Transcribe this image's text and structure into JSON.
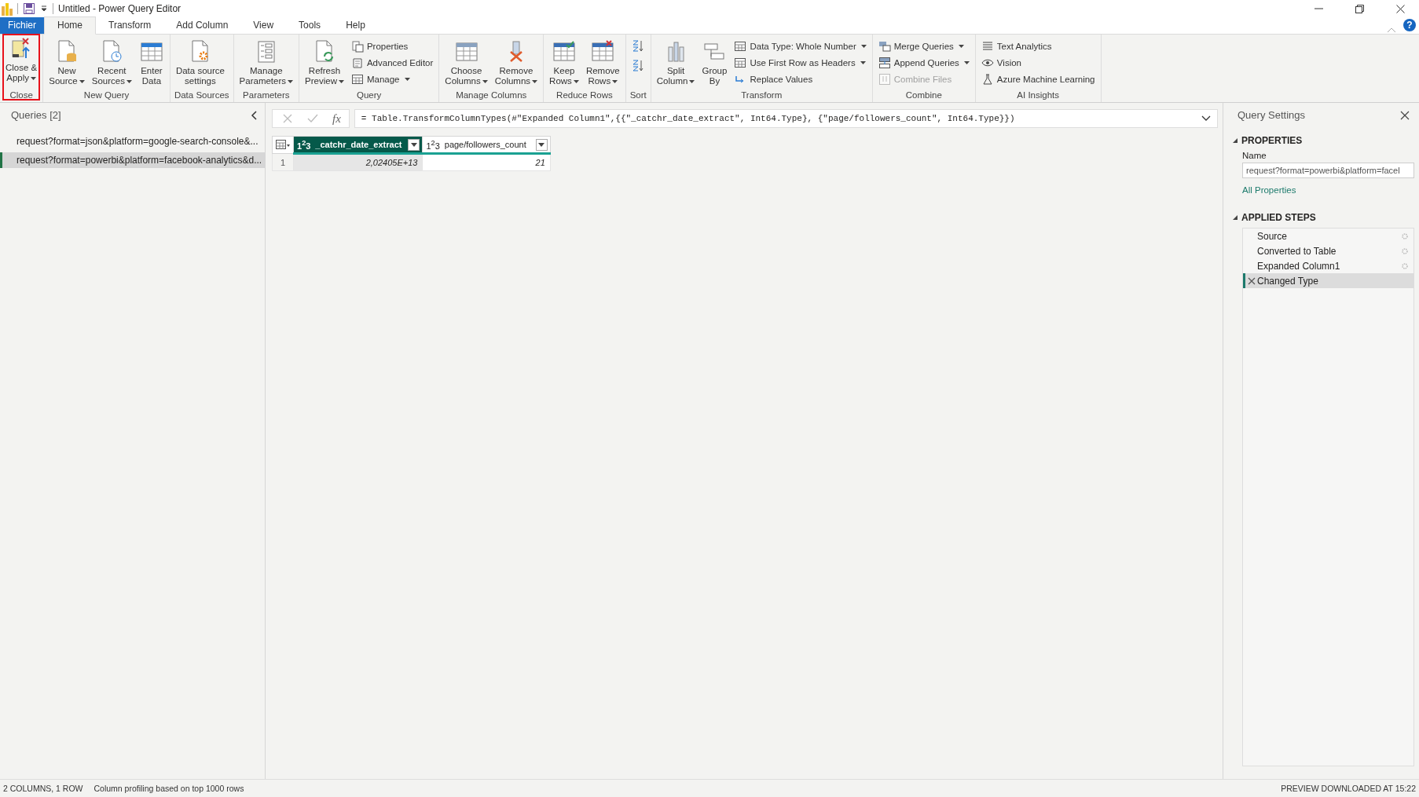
{
  "window": {
    "title": "Untitled - Power Query Editor",
    "help": "?"
  },
  "tabs": [
    {
      "label": "Fichier",
      "kind": "file",
      "selected": false
    },
    {
      "label": "Home",
      "kind": "tab",
      "selected": true
    },
    {
      "label": "Transform",
      "kind": "tab",
      "selected": false
    },
    {
      "label": "Add Column",
      "kind": "tab",
      "selected": false
    },
    {
      "label": "View",
      "kind": "tab",
      "selected": false
    },
    {
      "label": "Tools",
      "kind": "tab",
      "selected": false
    },
    {
      "label": "Help",
      "kind": "tab",
      "selected": false
    }
  ],
  "ribbon": [
    {
      "label": "Close",
      "items": [
        {
          "kind": "large",
          "lines": [
            "Close &",
            "Apply"
          ],
          "dropdown": true,
          "highlighted": true
        }
      ]
    },
    {
      "label": "New Query",
      "items": [
        {
          "kind": "large",
          "lines": [
            "New",
            "Source"
          ],
          "dropdown": true
        },
        {
          "kind": "large",
          "lines": [
            "Recent",
            "Sources"
          ],
          "dropdown": true
        },
        {
          "kind": "large",
          "lines": [
            "Enter",
            "Data"
          ],
          "dropdown": false
        }
      ]
    },
    {
      "label": "Data Sources",
      "items": [
        {
          "kind": "large",
          "lines": [
            "Data source",
            "settings"
          ],
          "dropdown": false
        }
      ]
    },
    {
      "label": "Parameters",
      "items": [
        {
          "kind": "large",
          "lines": [
            "Manage",
            "Parameters"
          ],
          "dropdown": true
        }
      ]
    },
    {
      "label": "Query",
      "items": [
        {
          "kind": "large",
          "lines": [
            "Refresh",
            "Preview"
          ],
          "dropdown": true
        },
        {
          "kind": "small",
          "label": "Properties",
          "dropdown": false,
          "disabled": false
        },
        {
          "kind": "small",
          "label": "Advanced Editor",
          "dropdown": false,
          "disabled": false
        },
        {
          "kind": "small",
          "label": "Manage",
          "dropdown": true,
          "disabled": false
        }
      ]
    },
    {
      "label": "Manage Columns",
      "items": [
        {
          "kind": "large",
          "lines": [
            "Choose",
            "Columns"
          ],
          "dropdown": true
        },
        {
          "kind": "large",
          "lines": [
            "Remove",
            "Columns"
          ],
          "dropdown": true
        }
      ]
    },
    {
      "label": "Reduce Rows",
      "items": [
        {
          "kind": "large",
          "lines": [
            "Keep",
            "Rows"
          ],
          "dropdown": true
        },
        {
          "kind": "large",
          "lines": [
            "Remove",
            "Rows"
          ],
          "dropdown": true
        }
      ]
    },
    {
      "label": "Sort",
      "items": [
        {
          "kind": "icon"
        },
        {
          "kind": "icon"
        }
      ]
    },
    {
      "label": "Transform",
      "items": [
        {
          "kind": "large",
          "lines": [
            "Split",
            "Column"
          ],
          "dropdown": true
        },
        {
          "kind": "large",
          "lines": [
            "Group",
            "By"
          ],
          "dropdown": false
        },
        {
          "kind": "small",
          "label": "Data Type: Whole Number",
          "dropdown": true,
          "disabled": false
        },
        {
          "kind": "small",
          "label": "Use First Row as Headers",
          "dropdown": true,
          "disabled": false
        },
        {
          "kind": "small",
          "label": "Replace Values",
          "dropdown": false,
          "disabled": false
        }
      ]
    },
    {
      "label": "Combine",
      "items": [
        {
          "kind": "small",
          "label": "Merge Queries",
          "dropdown": true,
          "disabled": false
        },
        {
          "kind": "small",
          "label": "Append Queries",
          "dropdown": true,
          "disabled": false
        },
        {
          "kind": "small",
          "label": "Combine Files",
          "dropdown": false,
          "disabled": true
        }
      ]
    },
    {
      "label": "AI Insights",
      "items": [
        {
          "kind": "small",
          "label": "Text Analytics",
          "dropdown": false,
          "disabled": false
        },
        {
          "kind": "small",
          "label": "Vision",
          "dropdown": false,
          "disabled": false
        },
        {
          "kind": "small",
          "label": "Azure Machine Learning",
          "dropdown": false,
          "disabled": false
        }
      ]
    }
  ],
  "queries": {
    "title": "Queries [2]",
    "items": [
      {
        "label": "request?format=json&platform=google-search-console&...",
        "selected": false
      },
      {
        "label": "request?format=powerbi&platform=facebook-analytics&d...",
        "selected": true
      }
    ]
  },
  "formula_bar": {
    "fx": "fx",
    "formula": "= Table.TransformColumnTypes(#\"Expanded Column1\",{{\"_catchr_date_extract\", Int64.Type}, {\"page/followers_count\", Int64.Type}})"
  },
  "table": {
    "columns": [
      {
        "type": "1$^{2}$3",
        "name": "_catchr_date_extract",
        "selected": true
      },
      {
        "type": "1$^{2}$3",
        "name": "page/followers_count",
        "selected": false
      }
    ],
    "rows": [
      {
        "number": "1",
        "cells": [
          "2,02405E+13",
          "21"
        ]
      }
    ]
  },
  "query_settings": {
    "title": "Query Settings",
    "properties_heading": "PROPERTIES",
    "name_label": "Name",
    "name_value": "request?format=powerbi&platform=facel",
    "all_properties": "All Properties",
    "steps_heading": "APPLIED STEPS",
    "steps": [
      {
        "label": "Source",
        "has_settings": true,
        "selected": false
      },
      {
        "label": "Converted to Table",
        "has_settings": true,
        "selected": false
      },
      {
        "label": "Expanded Column1",
        "has_settings": true,
        "selected": false
      },
      {
        "label": "Changed Type",
        "has_settings": false,
        "selected": true
      }
    ]
  },
  "status_bar": {
    "left": [
      "2 COLUMNS, 1 ROW",
      "Column profiling based on top 1000 rows"
    ],
    "right": "PREVIEW DOWNLOADED AT 15:22"
  }
}
